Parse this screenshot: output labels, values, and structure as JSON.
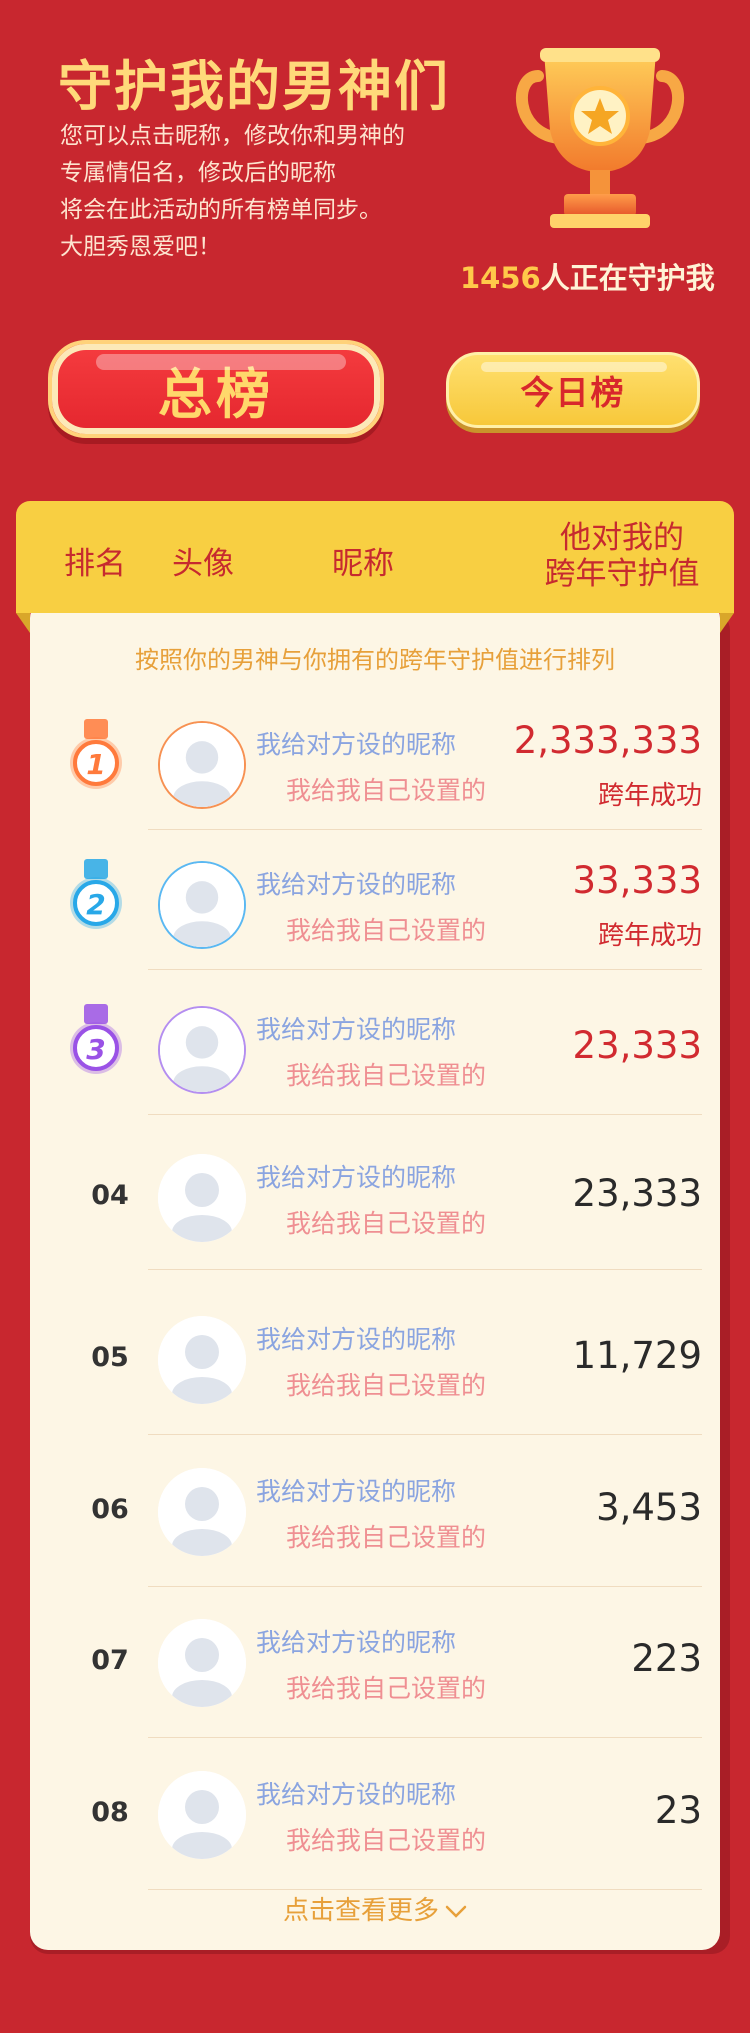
{
  "header": {
    "title": "守护我的男神们",
    "intro_lines": [
      "您可以点击昵称，修改你和男神的",
      "专属情侣名，修改后的昵称",
      "将会在此活动的所有榜单同步。",
      "大胆秀恩爱吧！"
    ],
    "guardian_count": "1456",
    "guardian_suffix": "人正在守护我",
    "trophy_icon": "trophy-icon"
  },
  "tabs": {
    "total": "总榜",
    "today": "今日榜"
  },
  "board": {
    "columns": {
      "rank": "排名",
      "avatar": "头像",
      "nickname": "昵称",
      "value_line1": "他对我的",
      "value_line2": "跨年守护值"
    },
    "note": "按照你的男神与你拥有的跨年守护值进行排列",
    "rows": [
      {
        "rank": "1",
        "nick_a": "我给对方设的昵称",
        "nick_b": "我给我自己设置的",
        "value": "2,333,333",
        "status": "跨年成功",
        "medal_color": "#ff7a3c"
      },
      {
        "rank": "2",
        "nick_a": "我给对方设的昵称",
        "nick_b": "我给我自己设置的",
        "value": "33,333",
        "status": "跨年成功",
        "medal_color": "#28a8e8"
      },
      {
        "rank": "3",
        "nick_a": "我给对方设的昵称",
        "nick_b": "我给我自己设置的",
        "value": "23,333",
        "status": "",
        "medal_color": "#9a52e6"
      },
      {
        "rank": "04",
        "nick_a": "我给对方设的昵称",
        "nick_b": "我给我自己设置的",
        "value": "23,333",
        "status": ""
      },
      {
        "rank": "05",
        "nick_a": "我给对方设的昵称",
        "nick_b": "我给我自己设置的",
        "value": "11,729",
        "status": ""
      },
      {
        "rank": "06",
        "nick_a": "我给对方设的昵称",
        "nick_b": "我给我自己设置的",
        "value": "3,453",
        "status": ""
      },
      {
        "rank": "07",
        "nick_a": "我给对方设的昵称",
        "nick_b": "我给我自己设置的",
        "value": "223",
        "status": ""
      },
      {
        "rank": "08",
        "nick_a": "我给对方设的昵称",
        "nick_b": "我给我自己设置的",
        "value": "23",
        "status": ""
      }
    ],
    "more": "点击查看更多"
  },
  "colors": {
    "background": "#c8272f",
    "gold": "#ffd97a",
    "highlight_red": "#d12a30",
    "panel": "#fdf6e5"
  }
}
